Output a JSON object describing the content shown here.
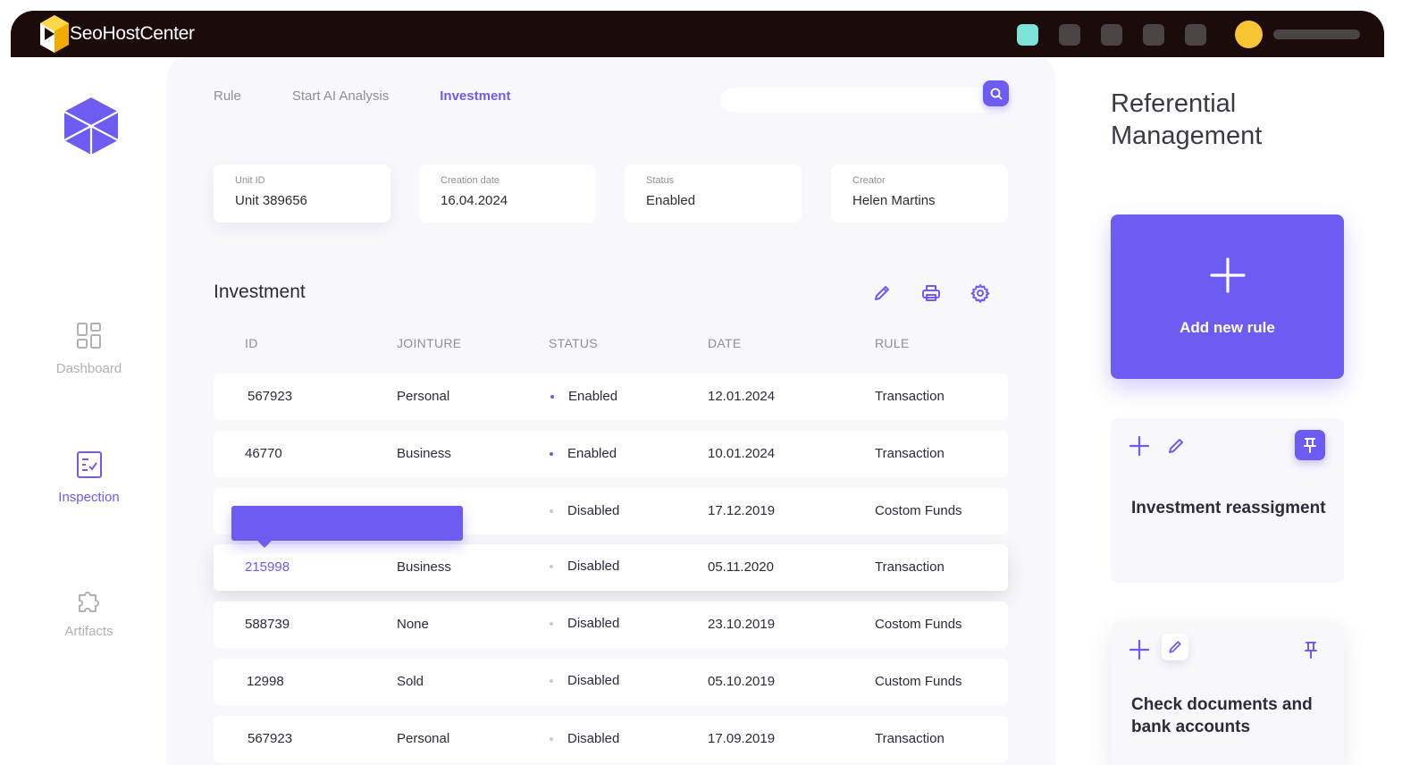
{
  "brand": {
    "name": "SeoHostCenter",
    "logo_icon": "seohostcenter-logo-icon"
  },
  "colors": {
    "accent": "#6e5cf2",
    "topbar": "#1b0b0b",
    "avatar": "#f7c533",
    "teal_chip": "#7de3d9",
    "disabled_dot": "#c8c8d0"
  },
  "sidebar": {
    "logo_icon": "cube-icon",
    "items": [
      {
        "label": "Dashboard",
        "icon": "dashboard-icon",
        "active": false
      },
      {
        "label": "Inspection",
        "icon": "inspection-icon",
        "active": true
      },
      {
        "label": "Artifacts",
        "icon": "puzzle-icon",
        "active": false
      }
    ]
  },
  "tabs": [
    {
      "label": "Rule",
      "active": false
    },
    {
      "label": "Start AI Analysis",
      "active": false
    },
    {
      "label": "Investment",
      "active": true
    }
  ],
  "search": {
    "value": "",
    "placeholder": "",
    "icon": "search-icon"
  },
  "info_cards": [
    {
      "label": "Unit ID",
      "value": "Unit 389656"
    },
    {
      "label": "Creation date",
      "value": "16.04.2024"
    },
    {
      "label": "Status",
      "value": "Enabled"
    },
    {
      "label": "Creator",
      "value": "Helen Martins"
    }
  ],
  "table": {
    "title": "Investment",
    "tools": [
      "edit-icon",
      "print-icon",
      "settings-icon"
    ],
    "columns": [
      "ID",
      "JOINTURE",
      "STATUS",
      "DATE",
      "RULE"
    ],
    "rows": [
      {
        "id": "567923",
        "jointure": "Personal",
        "status": "Enabled",
        "date": "12.01.2024",
        "rule": "Transaction"
      },
      {
        "id": "46770",
        "jointure": "Business",
        "status": "Enabled",
        "date": "10.01.2024",
        "rule": "Transaction"
      },
      {
        "id": "",
        "jointure": "",
        "status": "Disabled",
        "date": "17.12.2019",
        "rule": "Costom Funds"
      },
      {
        "id": "215998",
        "jointure": "Business",
        "status": "Disabled",
        "date": "05.11.2020",
        "rule": "Transaction"
      },
      {
        "id": "588739",
        "jointure": "None",
        "status": "Disabled",
        "date": "23.10.2019",
        "rule": "Costom Funds"
      },
      {
        "id": "12998",
        "jointure": "Sold",
        "status": "Disabled",
        "date": "05.10.2019",
        "rule": "Custom Funds"
      },
      {
        "id": "567923",
        "jointure": "Personal",
        "status": "Disabled",
        "date": "17.09.2019",
        "rule": "Transaction"
      }
    ]
  },
  "right_panel": {
    "title": "Referential Management",
    "add_rule_label": "Add new rule",
    "cards": [
      {
        "title": "Investment reassigment",
        "pinned": true
      },
      {
        "title": "Check documents and bank accounts",
        "pinned": false
      }
    ]
  }
}
